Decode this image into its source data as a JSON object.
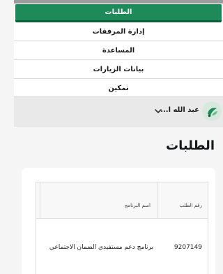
{
  "nav": {
    "items": [
      {
        "label": "الطلبات",
        "active": true
      },
      {
        "label": "إدارة المرفقات"
      },
      {
        "label": "المساعدة"
      },
      {
        "label": "بيانات الزيارات"
      },
      {
        "label": "تمكين"
      }
    ]
  },
  "user": {
    "name": "عبد الله ا..."
  },
  "page": {
    "title": "الطلبات"
  },
  "table": {
    "columns": [
      "رقم الطلب",
      "اسم البرنامج"
    ],
    "rows": [
      [
        "9207149",
        "برنامج دعم مستفيدي الضمان الاجتماعي"
      ]
    ]
  },
  "colors": {
    "accent": "#1e8a5a",
    "accent_dark": "#0f5c3a"
  }
}
